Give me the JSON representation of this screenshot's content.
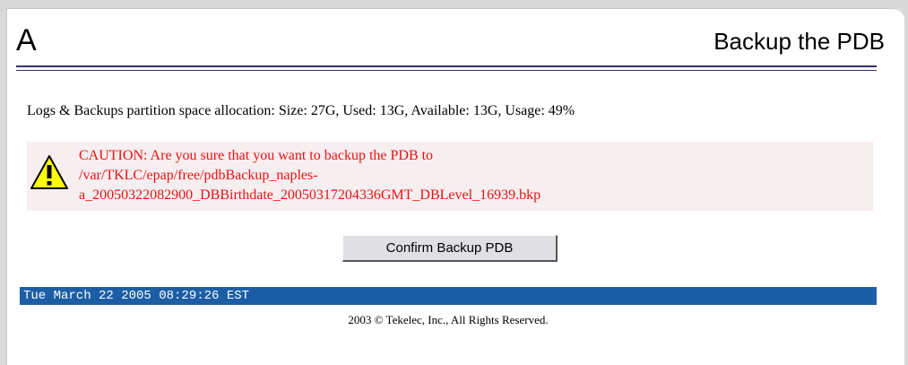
{
  "header": {
    "letter": "A",
    "title": "Backup the PDB"
  },
  "partition_info": "Logs & Backups partition space allocation: Size: 27G, Used: 13G, Available: 13G, Usage: 49%",
  "caution": {
    "icon": "warning-icon",
    "lines": [
      "CAUTION: Are you sure that you want to backup the PDB to",
      "/var/TKLC/epap/free/pdbBackup_naples-",
      "a_20050322082900_DBBirthdate_20050317204336GMT_DBLevel_16939.bkp"
    ]
  },
  "confirm_button_label": "Confirm Backup PDB",
  "status_datetime": "Tue March 22 2005 08:29:26 EST",
  "copyright": "2003 © Tekelec, Inc., All Rights Reserved.",
  "colors": {
    "status_bar": "#1c5ea5",
    "caution_text": "#ee1111",
    "caution_background": "#f7eef0",
    "rule": "#333366"
  }
}
